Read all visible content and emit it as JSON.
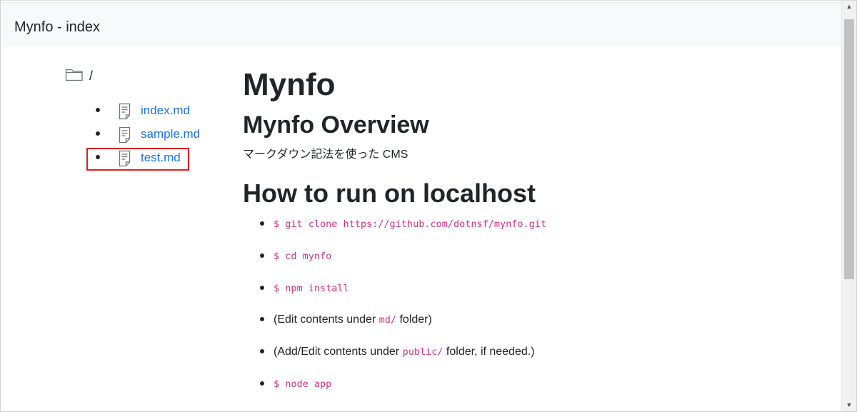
{
  "navbar": {
    "brand": "Mynfo - index"
  },
  "sidebar": {
    "folder_label": "/",
    "files": [
      {
        "name": "index.md"
      },
      {
        "name": "sample.md"
      },
      {
        "name": "test.md",
        "highlighted": true
      }
    ],
    "highlight_color": "#e02020",
    "link_color": "#1a73e8"
  },
  "content": {
    "title": "Mynfo",
    "overview_heading": "Mynfo Overview",
    "overview_text": "マークダウン記法を使った CMS",
    "howto_heading": "How to run on localhost",
    "steps": [
      {
        "code": "$ git clone https://github.com/dotnsf/mynfo.git"
      },
      {
        "code": "$ cd mynfo"
      },
      {
        "code": "$ npm install"
      },
      {
        "before": "(Edit contents under ",
        "code": "md/",
        "after": " folder)"
      },
      {
        "before": "(Add/Edit contents under ",
        "code": "public/",
        "after": " folder, if needed.)"
      },
      {
        "code": "$ node app"
      }
    ],
    "code_color": "#d63384"
  }
}
